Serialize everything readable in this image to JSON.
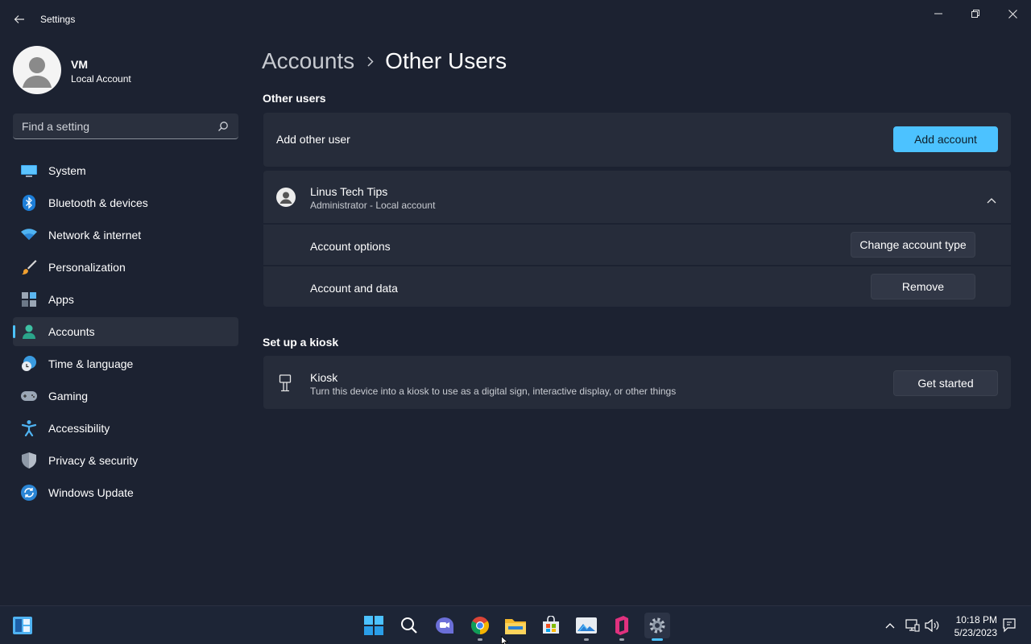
{
  "window": {
    "title": "Settings"
  },
  "profile": {
    "name": "VM",
    "account_type": "Local Account"
  },
  "search": {
    "placeholder": "Find a setting"
  },
  "sidebar": {
    "items": [
      {
        "label": "System",
        "icon": "monitor-icon",
        "active": false
      },
      {
        "label": "Bluetooth & devices",
        "icon": "bluetooth-icon",
        "active": false
      },
      {
        "label": "Network & internet",
        "icon": "wifi-icon",
        "active": false
      },
      {
        "label": "Personalization",
        "icon": "paintbrush-icon",
        "active": false
      },
      {
        "label": "Apps",
        "icon": "apps-icon",
        "active": false
      },
      {
        "label": "Accounts",
        "icon": "person-icon",
        "active": true
      },
      {
        "label": "Time & language",
        "icon": "clock-globe-icon",
        "active": false
      },
      {
        "label": "Gaming",
        "icon": "gamepad-icon",
        "active": false
      },
      {
        "label": "Accessibility",
        "icon": "accessibility-icon",
        "active": false
      },
      {
        "label": "Privacy & security",
        "icon": "shield-icon",
        "active": false
      },
      {
        "label": "Windows Update",
        "icon": "update-icon",
        "active": false
      }
    ]
  },
  "breadcrumb": {
    "parent": "Accounts",
    "current": "Other Users"
  },
  "other_users": {
    "section_title": "Other users",
    "add_row_label": "Add other user",
    "add_button": "Add account",
    "user": {
      "name": "Linus Tech Tips",
      "detail": "Administrator - Local account",
      "options_label": "Account options",
      "options_button": "Change account type",
      "data_label": "Account and data",
      "data_button": "Remove"
    }
  },
  "kiosk": {
    "section_title": "Set up a kiosk",
    "title": "Kiosk",
    "description": "Turn this device into a kiosk to use as a digital sign, interactive display, or other things",
    "button": "Get started"
  },
  "taskbar": {
    "time": "10:18 PM",
    "date": "5/23/2023",
    "apps": [
      "start-icon",
      "search-icon",
      "chat-icon",
      "chrome-icon",
      "file-explorer-icon",
      "store-icon",
      "photos-icon",
      "app-icon",
      "settings-icon"
    ]
  },
  "colors": {
    "accent": "#4cc2ff",
    "background": "#1c2231",
    "card": "#262c3a"
  }
}
